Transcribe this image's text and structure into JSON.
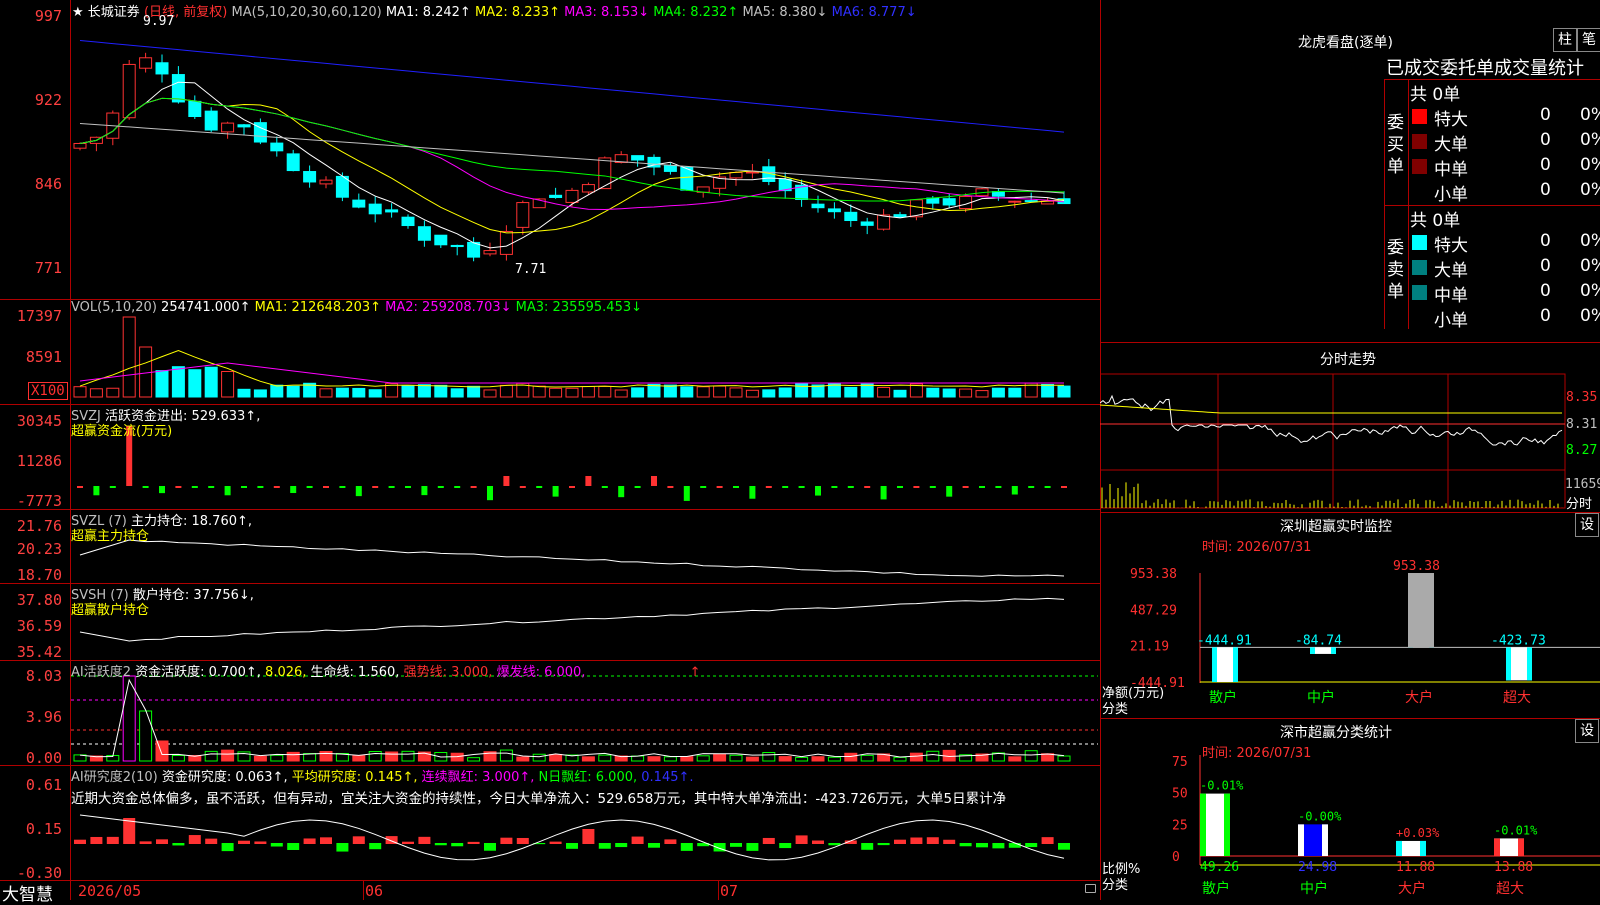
{
  "stock": {
    "star": "★",
    "name": "长城证券",
    "period": "(日线, 前复权)",
    "ma_label": "MA(5,10,20,30,60,120)",
    "ma1": "MA1: 8.242↑",
    "ma2": "MA2: 8.233↑",
    "ma3": "MA3: 8.153↓",
    "ma4": "MA4: 8.232↑",
    "ma5": "MA5: 8.380↓",
    "ma6": "MA6: 8.777↓",
    "high_mark": "9.97",
    "low_mark": "7.71"
  },
  "price_axis": [
    "997",
    "922",
    "846",
    "771"
  ],
  "vol": {
    "label": "VOL(5,10,20)",
    "value": "254741.000↑",
    "ma1": "MA1: 212648.203↑",
    "ma2": "MA2: 259208.703↓",
    "ma3": "MA3: 235595.453↓",
    "axis": [
      "17397",
      "8591"
    ],
    "unit": "X100"
  },
  "svzj": {
    "label": "SVZJ",
    "value": "活跃资金进出: 529.633↑,",
    "sub": "超赢资金流(万元)",
    "axis": [
      "30345",
      "11286",
      "-7773"
    ]
  },
  "svzl": {
    "label": "SVZL (7)",
    "value": "主力持仓: 18.760↑,",
    "sub": "超赢主力持仓",
    "axis": [
      "21.76",
      "20.23",
      "18.70"
    ]
  },
  "svsh": {
    "label": "SVSH (7)",
    "value": "散户持仓: 37.756↓,",
    "sub": "超赢散户持仓",
    "axis": [
      "37.80",
      "36.59",
      "35.42"
    ]
  },
  "ai1": {
    "label": "AI活跃度2",
    "v1": "资金活跃度: 0.700↑,",
    "v2": "8.026,",
    "v3": "生命线: 1.560,",
    "v4": "强势线: 3.000,",
    "v5": "爆发线: 6.000,",
    "arrow": "↑",
    "axis": [
      "8.03",
      "3.96",
      "0.00"
    ]
  },
  "ai2": {
    "label": "AI研究度2(10)",
    "v1": "资金研究度: 0.063↑,",
    "v2": "平均研究度: 0.145↑,",
    "v3": "连续飘红: 3.000↑,",
    "v4": "N日飘红: 6.000,",
    "v5": "0.145↑.",
    "desc": "近期大资金总体偏多，虽不活跃，但有异动，宜关注大资金的持续性，今日大单净流入：529.658万元，其中特大单净流出：-423.726万元，大单5日累计净",
    "axis": [
      "0.61",
      "0.15",
      "-0.30"
    ]
  },
  "date_axis": [
    "2026/05",
    "06",
    "07"
  ],
  "brand": "大智慧",
  "right": {
    "lhb_title": "龙虎看盘(逐单)",
    "btn_zhu": "柱",
    "btn_bi": "笔",
    "stat_title": "已成交委托单成交量统计",
    "buy_label": "委买单",
    "sell_label": "委卖单",
    "buy_total": "共 0单",
    "sell_total": "共 0单",
    "buy_rows": [
      {
        "name": "特大",
        "n": "0",
        "p": "0%"
      },
      {
        "name": "大单",
        "n": "0",
        "p": "0%"
      },
      {
        "name": "中单",
        "n": "0",
        "p": "0%"
      },
      {
        "name": "小单",
        "n": "0",
        "p": "0%"
      }
    ],
    "sell_rows": [
      {
        "name": "特大",
        "n": "0",
        "p": "0%"
      },
      {
        "name": "大单",
        "n": "0",
        "p": "0%"
      },
      {
        "name": "中单",
        "n": "0",
        "p": "0%"
      },
      {
        "name": "小单",
        "n": "0",
        "p": "0%"
      }
    ],
    "fs_title": "分时走势",
    "fs_axis": [
      "8.35",
      "8.31",
      "8.27"
    ],
    "fs_vol": "11659",
    "fs_unit": "分时",
    "monitor_title": "深圳超赢实时监控",
    "monitor_time": "时间: 2026/07/31",
    "monitor_btn": "设",
    "monitor_axis": [
      "953.38",
      "487.29",
      "21.19",
      "-444.91"
    ],
    "monitor_bars": [
      {
        "label": "散户",
        "value": "-444.91"
      },
      {
        "label": "中户",
        "value": "-84.74"
      },
      {
        "label": "大户",
        "value": "953.38"
      },
      {
        "label": "超大",
        "value": "-423.73"
      }
    ],
    "monitor_net": "净额(万元)",
    "monitor_cat": "分类",
    "class_title": "深市超赢分类统计",
    "class_time": "时间: 2026/07/31",
    "class_btn": "设",
    "class_axis": [
      "75",
      "50",
      "25",
      "0"
    ],
    "class_bars": [
      {
        "label": "散户",
        "pct": "-0.01%",
        "value": "49.26"
      },
      {
        "label": "中户",
        "pct": "-0.00%",
        "value": "24.98"
      },
      {
        "label": "大户",
        "pct": "+0.03%",
        "value": "11.88"
      },
      {
        "label": "超大",
        "pct": "-0.01%",
        "value": "13.88"
      }
    ],
    "class_ratio": "比例%",
    "class_cat": "分类"
  },
  "colors": {
    "up": "#ff3232",
    "down": "#00ffff",
    "ma1": "#ffffff",
    "ma2": "#ffff00",
    "ma3": "#ff00ff",
    "ma4": "#00ff00",
    "ma5": "#c0c0c0",
    "ma6": "#2020ff"
  }
}
